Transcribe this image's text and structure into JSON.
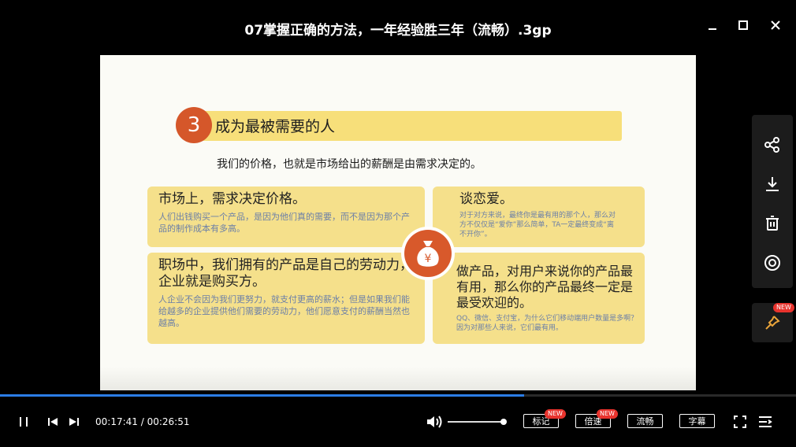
{
  "window": {
    "title": "07掌握正确的方法，一年经验胜三年（流畅）.3gp",
    "minimize_icon": "minimize-icon",
    "maximize_icon": "maximize-icon",
    "close_icon": "close-icon"
  },
  "slide": {
    "heading_number": "3",
    "heading": "成为最被需要的人",
    "lead": "我们的价格，也就是市场给出的薪酬是由需求决定的。",
    "cards": [
      {
        "title": "市场上，需求决定价格。",
        "body": "人们出钱购买一个产品，是因为他们真的需要，而不是因为那个产品的制作成本有多高。"
      },
      {
        "title": "谈恋爱。",
        "body": "对于对方来说，最终你是最有用的那个人，那么对方不仅仅是“爱你”那么简单，TA一定最终变成“离不开你”。"
      },
      {
        "title": "职场中，我们拥有的产品是自己的劳动力，企业就是购买方。",
        "body": "人企业不会因为我们更努力，就支付更高的薪水；但是如果我们能给越多的企业提供他们需要的劳动力，他们愿意支付的薪酬当然也越高。"
      },
      {
        "title": "做产品，对用户来说你的产品最有用，那么你的产品最终一定是最受欢迎的。",
        "body": "QQ、微信、支付宝，为什么它们移动端用户数量是多啊？因为对那些人来说，它们最有用。"
      }
    ],
    "center_icon": "money-bag-icon",
    "center_symbol": "¥"
  },
  "sidebar": {
    "icons": [
      "share-icon",
      "download-icon",
      "delete-icon",
      "target-icon"
    ],
    "pin_icon": "pin-icon",
    "pin_badge": "NEW"
  },
  "player": {
    "progress": 0.658,
    "current_time": "00:17:41",
    "total_time": "00:26:51",
    "time_separator": " / ",
    "volume": 0.95,
    "buttons": {
      "mark": "标记",
      "mark_badge": "NEW",
      "speed": "倍速",
      "speed_badge": "NEW",
      "quality": "流畅",
      "subtitle": "字幕"
    }
  },
  "colors": {
    "accent": "#2b7de6",
    "card": "#f5e08b",
    "heading_bar": "#f7df7a",
    "badge": "#d5572a",
    "new_badge": "#e8332d"
  }
}
